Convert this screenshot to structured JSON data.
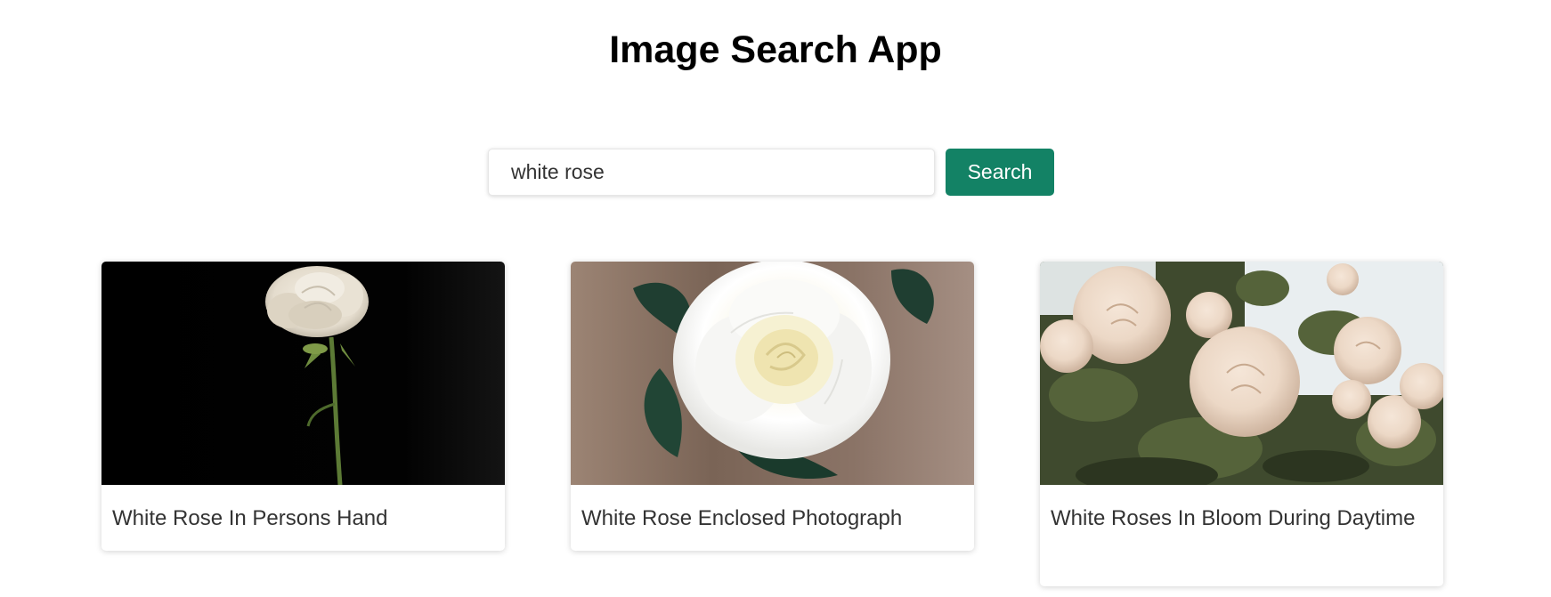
{
  "header": {
    "title": "Image Search App"
  },
  "search": {
    "value": "white rose",
    "placeholder": "",
    "button_label": "Search"
  },
  "results": [
    {
      "caption": "White Rose In Persons Hand",
      "image": "white-rose-single-stem-on-black-photo"
    },
    {
      "caption": "White Rose Enclosed Photograph",
      "image": "white-rose-closeup-photo"
    },
    {
      "caption": "White Roses In Bloom During Daytime",
      "image": "white-roses-bush-photo"
    }
  ],
  "colors": {
    "accent": "#138265",
    "text": "#333333",
    "title": "#000000"
  }
}
